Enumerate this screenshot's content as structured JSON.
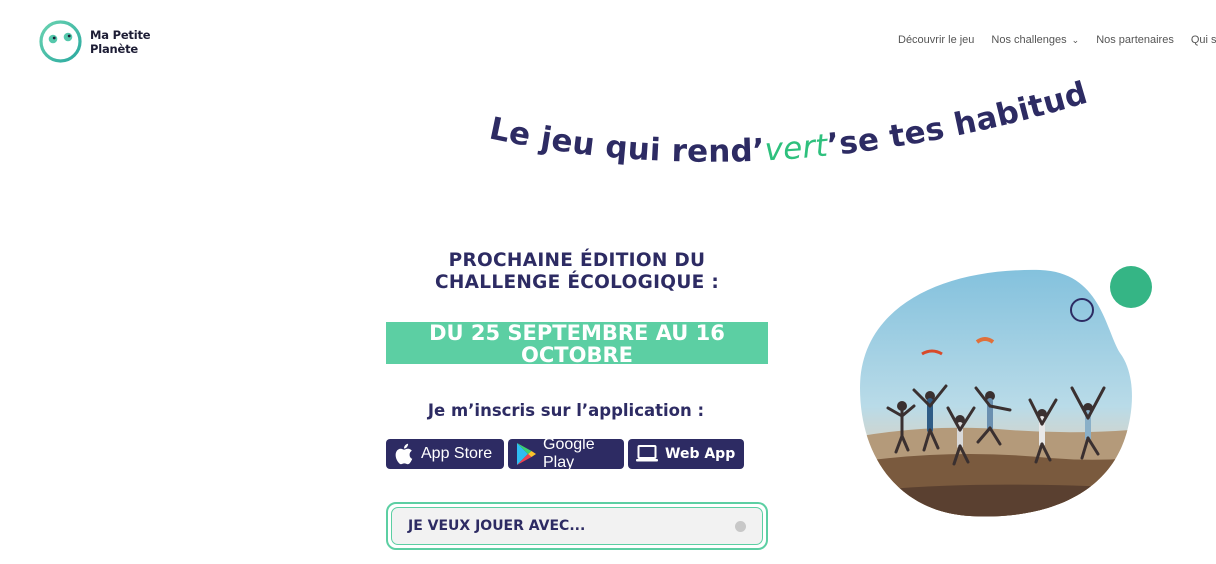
{
  "brand": {
    "name_line1": "Ma Petite",
    "name_line2": "Planète",
    "accent": "#5ccfa3",
    "navy": "#2d2b63"
  },
  "nav": {
    "items": [
      {
        "label": "Découvrir le jeu",
        "has_dropdown": false
      },
      {
        "label": "Nos challenges",
        "has_dropdown": true
      },
      {
        "label": "Nos partenaires",
        "has_dropdown": false
      },
      {
        "label": "Qui so",
        "has_dropdown": false
      }
    ]
  },
  "headline": {
    "part1": "Le jeu qui rend’",
    "highlight": "vert",
    "part2": "’se tes habitudes !"
  },
  "edition": {
    "title": "PROCHAINE ÉDITION DU CHALLENGE ÉCOLOGIQUE :",
    "dates": "DU 25 SEPTEMBRE AU 16 OCTOBRE"
  },
  "signup": {
    "label": "Je m’inscris sur l’application :",
    "app_store": "App Store",
    "google_play": "Google Play",
    "web_app": "Web App"
  },
  "partner_select": {
    "label": "JE VEUX JOUER AVEC..."
  }
}
